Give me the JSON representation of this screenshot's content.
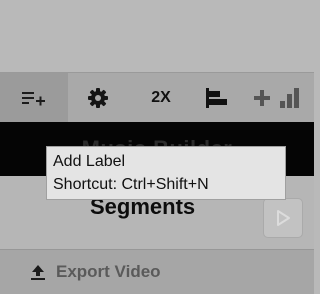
{
  "toolbar": {
    "zoom_label": "2X",
    "items": [
      {
        "icon": "add-list-icon",
        "active": true
      },
      {
        "icon": "gear-icon"
      },
      {
        "icon": "align-left-bars-icon"
      },
      {
        "icon": "plus-icon"
      },
      {
        "icon": "bar-chart-icon"
      }
    ]
  },
  "panel": {
    "title": "Music Builder",
    "segments_label": "Segments",
    "play_icon": "play-icon"
  },
  "export": {
    "label": "Export Video",
    "icon": "upload-icon"
  },
  "tooltip": {
    "title": "Add Label",
    "shortcut": "Shortcut: Ctrl+Shift+N"
  },
  "colors": {
    "background": "#b9b9b9",
    "toolbar": "#a9a9a9",
    "active_button": "#9b9b9b",
    "title_bar": "#050505",
    "tooltip_bg": "#e4e4e4"
  }
}
